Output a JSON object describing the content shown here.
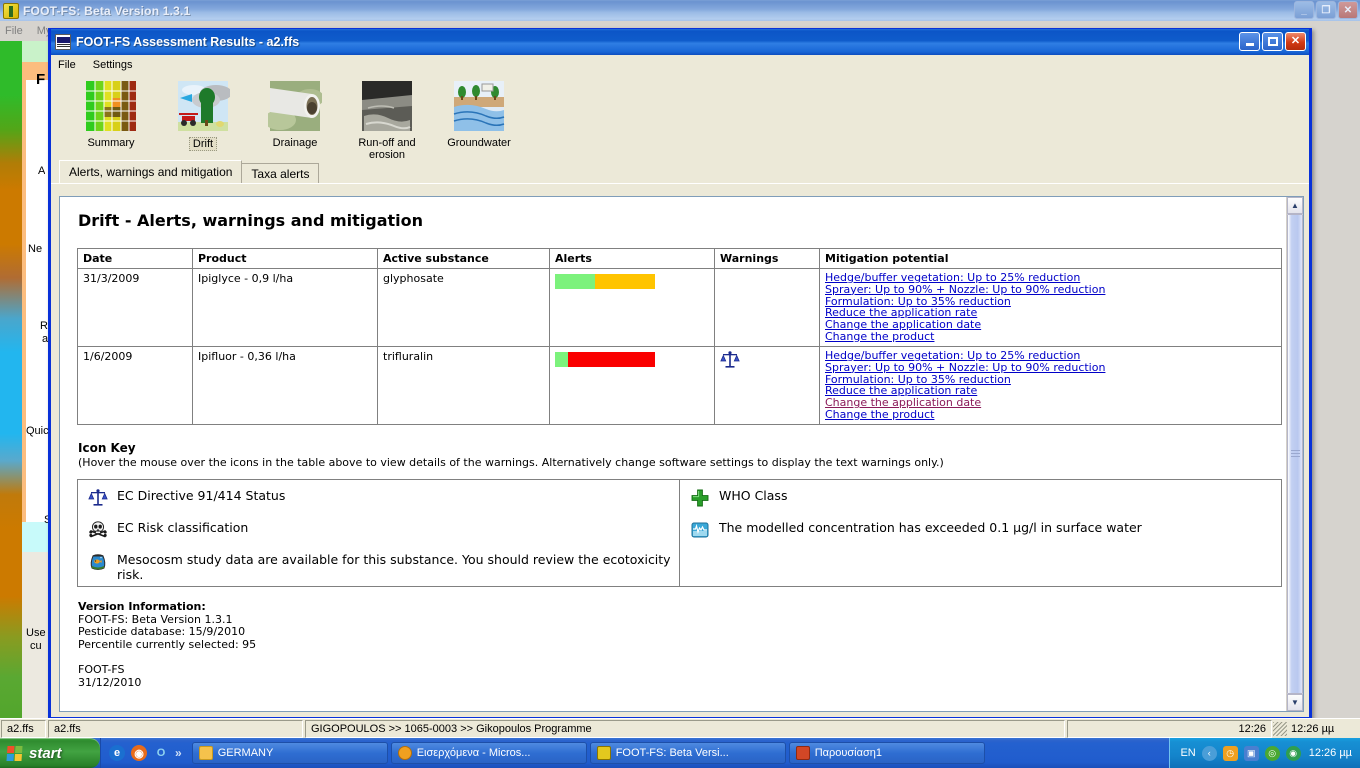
{
  "outer_window": {
    "title": "FOOT-FS: Beta Version 1.3.1",
    "menu": [
      "File",
      "My"
    ],
    "buttons": {
      "minimize": "_",
      "maximize": "❐",
      "close": "✕"
    },
    "background_fragments": [
      {
        "text": "F"
      },
      {
        "text": "A"
      },
      {
        "text": "Ne"
      },
      {
        "text": "R"
      },
      {
        "text": "a"
      },
      {
        "text": "Quic"
      },
      {
        "text": "S"
      },
      {
        "text": "Use"
      },
      {
        "text": "cu"
      }
    ]
  },
  "inner_window": {
    "title": "FOOT-FS Assessment Results  -  a2.ffs",
    "menu": [
      "File",
      "Settings"
    ],
    "toolbar": [
      {
        "label": "Summary",
        "icon": "summary-matrix-icon",
        "selected": false
      },
      {
        "label": "Drift",
        "icon": "drift-sprayer-icon",
        "selected": true
      },
      {
        "label": "Drainage",
        "icon": "drainage-pipe-icon",
        "selected": false
      },
      {
        "label": "Run-off and erosion",
        "icon": "runoff-erosion-icon",
        "selected": false
      },
      {
        "label": "Groundwater",
        "icon": "groundwater-icon",
        "selected": false
      }
    ],
    "tabs": [
      {
        "label": "Alerts, warnings and mitigation",
        "active": true
      },
      {
        "label": "Taxa alerts",
        "active": false
      }
    ]
  },
  "report": {
    "heading": "Drift - Alerts, warnings and mitigation",
    "table": {
      "headers": [
        "Date",
        "Product",
        "Active substance",
        "Alerts",
        "Warnings",
        "Mitigation potential"
      ],
      "rows": [
        {
          "date": "31/3/2009",
          "product": "Ipiglyce - 0,9 l/ha",
          "active_substance": "glyphosate",
          "alert_segments": [
            {
              "color": "#7cf27c",
              "width_pct": 40
            },
            {
              "color": "#ffc400",
              "width_pct": 60
            }
          ],
          "warnings": [],
          "mitigation": [
            {
              "text": "Hedge/buffer vegetation: Up to 25% reduction",
              "visited": false
            },
            {
              "text": "Sprayer: Up to 90% + Nozzle: Up to 90% reduction",
              "visited": false
            },
            {
              "text": "Formulation: Up to 35% reduction",
              "visited": false
            },
            {
              "text": "Reduce the application rate",
              "visited": false
            },
            {
              "text": "Change the application date",
              "visited": false
            },
            {
              "text": "Change the product",
              "visited": false
            }
          ]
        },
        {
          "date": "1/6/2009",
          "product": "Ipifluor - 0,36 l/ha",
          "active_substance": "trifluralin",
          "alert_segments": [
            {
              "color": "#7cf27c",
              "width_pct": 13
            },
            {
              "color": "#fa0000",
              "width_pct": 87
            }
          ],
          "warnings": [
            "scales-icon"
          ],
          "mitigation": [
            {
              "text": "Hedge/buffer vegetation: Up to 25% reduction",
              "visited": false
            },
            {
              "text": "Sprayer: Up to 90% + Nozzle: Up to 90% reduction",
              "visited": false
            },
            {
              "text": "Formulation: Up to 35% reduction",
              "visited": false
            },
            {
              "text": "Reduce the application rate",
              "visited": false
            },
            {
              "text": "Change the application date",
              "visited": true
            },
            {
              "text": "Change the product",
              "visited": false
            }
          ]
        }
      ]
    },
    "icon_key": {
      "title": "Icon Key",
      "subtitle": "(Hover the mouse over the icons in the table above to view details of the warnings. Alternatively change software settings to display the text warnings only.)",
      "left_items": [
        {
          "icon": "scales-icon",
          "text": "EC Directive 91/414 Status"
        },
        {
          "icon": "skull-crossbones-icon",
          "text": "EC Risk classification"
        },
        {
          "icon": "fishbowl-icon",
          "text": "Mesocosm study data are available for this substance. You should review the ecotoxicity risk."
        }
      ],
      "right_items": [
        {
          "icon": "green-cross-icon",
          "text": "WHO Class"
        },
        {
          "icon": "water-chart-icon",
          "text": "The modelled concentration has exceeded 0.1 µg/l in surface water"
        }
      ]
    },
    "version_info": {
      "heading": "Version Information:",
      "lines": [
        "FOOT-FS: Beta Version 1.3.1",
        "Pesticide database: 15/9/2010",
        "Percentile currently selected: 95"
      ],
      "footer": [
        "FOOT-FS",
        "31/12/2010"
      ]
    }
  },
  "statusbar": {
    "cells": [
      "a2.ffs",
      "a2.ffs",
      "GIGOPOULOS >> 1065-0003 >> Gikopoulos Programme",
      "12:26"
    ],
    "clock": "12:26 µµ"
  },
  "taskbar": {
    "start_label": "start",
    "quicklaunch": [
      {
        "icon": "internet-explorer-icon",
        "color": "#1a6fd0"
      },
      {
        "icon": "firefox-icon",
        "color": "#e86b1a"
      },
      {
        "icon": "opera-icon",
        "color": "#8fd3f0"
      }
    ],
    "quicklaunch_overflow": "»",
    "tasks": [
      {
        "label": "GERMANY",
        "icon": "folder-icon",
        "color": "#f5c24c"
      },
      {
        "label": "Εισερχόμενα - Micros...",
        "icon": "outlook-icon",
        "color": "#f0a020"
      },
      {
        "label": "FOOT-FS: Beta Versi...",
        "icon": "footfs-icon",
        "color": "#e3c81e"
      },
      {
        "label": "Παρουσίαση1",
        "icon": "powerpoint-icon",
        "color": "#d24726"
      }
    ],
    "tray": {
      "language": "EN",
      "chevron": "‹",
      "icons": [
        {
          "name": "clock-tray-icon",
          "color": "#f0a020"
        },
        {
          "name": "network-tray-icon",
          "color": "#4a7fd0"
        },
        {
          "name": "spiral-tray-icon",
          "color": "#4aa832"
        },
        {
          "name": "shield-tray-icon",
          "color": "#2f9e4f"
        }
      ],
      "clock": "12:26 µµ"
    }
  }
}
